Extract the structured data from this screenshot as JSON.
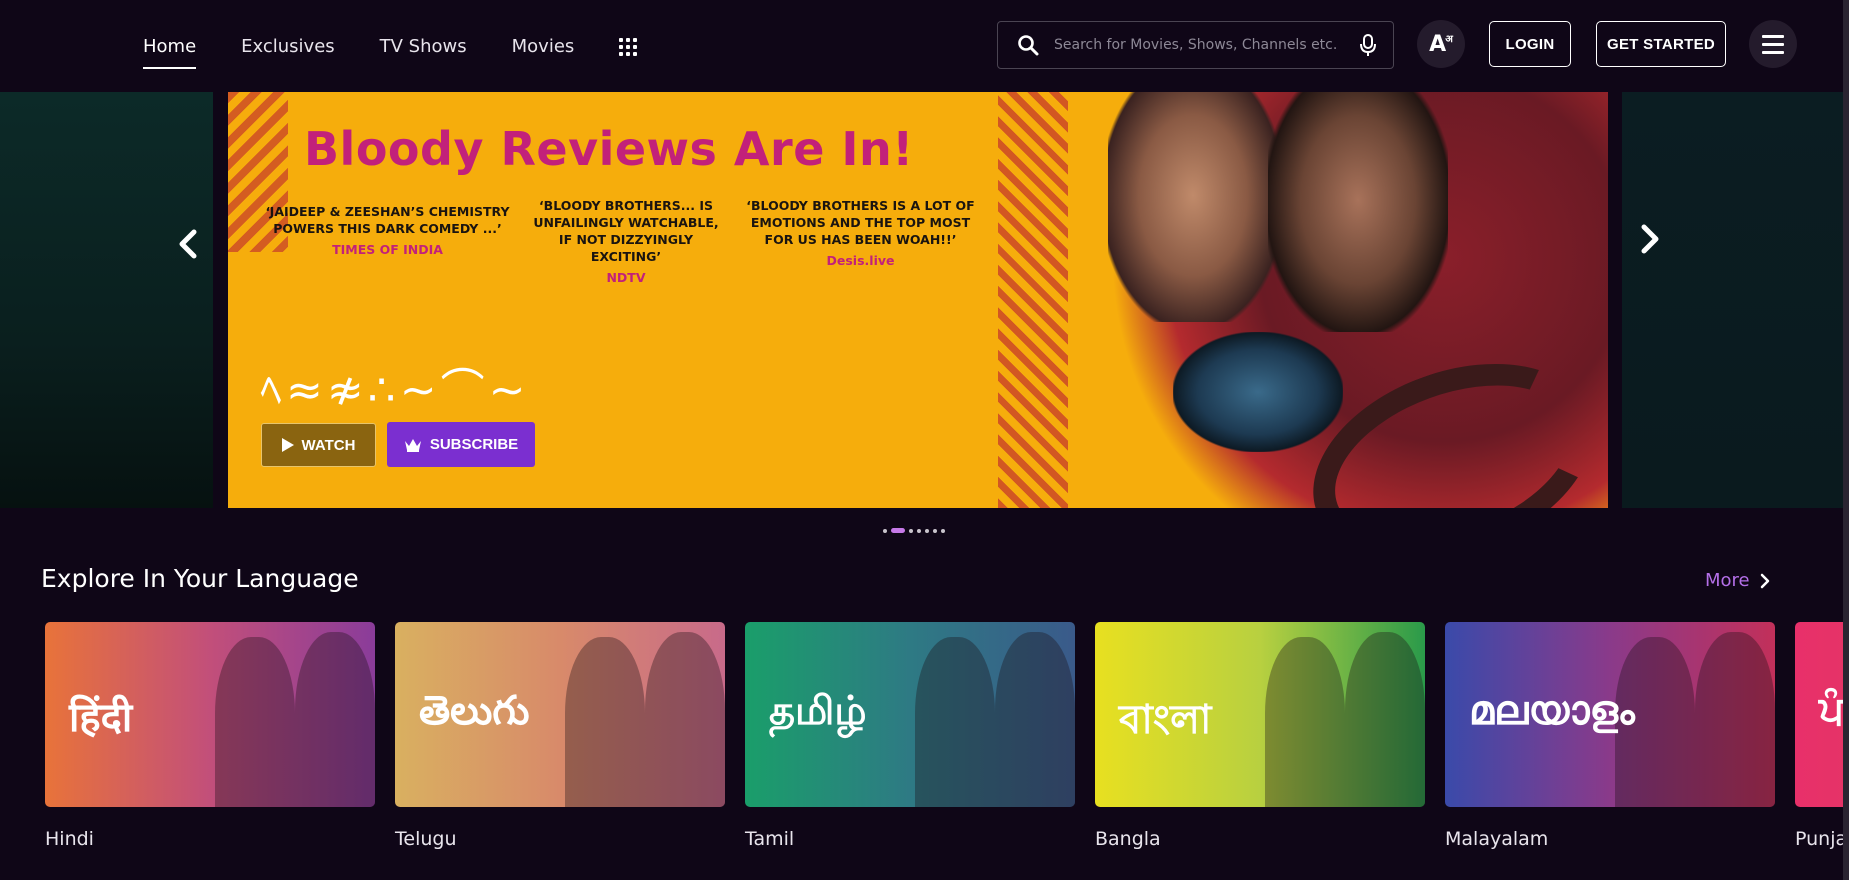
{
  "nav": {
    "items": [
      "Home",
      "Exclusives",
      "TV Shows",
      "Movies"
    ],
    "active": "Home"
  },
  "search": {
    "placeholder": "Search for Movies, Shows, Channels etc."
  },
  "header": {
    "language_icon_label": "A",
    "language_icon_sup": "अ",
    "login_label": "LOGIN",
    "get_started_label": "GET STARTED"
  },
  "hero": {
    "title": "Bloody Reviews Are In!",
    "quotes": [
      {
        "text": "‘JAIDEEP & ZEESHAN’S CHEMISTRY POWERS THIS DARK COMEDY ...’",
        "source": "TIMES OF INDIA"
      },
      {
        "text": "‘BLOODY BROTHERS... IS UNFAILINGLY WATCHABLE, IF NOT DIZZYINGLY EXCITING’",
        "source": "NDTV"
      },
      {
        "text": "‘BLOODY BROTHERS IS A LOT OF EMOTIONS AND THE TOP MOST FOR US HAS BEEN WOAH!!’",
        "source": "Desis.live"
      }
    ],
    "show_logo_text": "ﾍ≈≉∴∼⌒∼",
    "watch_label": "WATCH",
    "subscribe_label": "SUBSCRIBE",
    "slide_count": 7,
    "active_slide": 2
  },
  "explore": {
    "title": "Explore In Your Language",
    "more_label": "More",
    "languages": [
      {
        "label": "Hindi",
        "script": "हिंदी",
        "gradient": [
          "#e8733a",
          "#c24f7a",
          "#8a3c9a"
        ]
      },
      {
        "label": "Telugu",
        "script": "తెలుగు",
        "gradient": [
          "#d9b060",
          "#d88a6a",
          "#c86a8a"
        ]
      },
      {
        "label": "Tamil",
        "script": "தமிழ்",
        "gradient": [
          "#1a9e6a",
          "#2e7a84",
          "#3a5a8a"
        ]
      },
      {
        "label": "Bangla",
        "script": "বাংলা",
        "gradient": [
          "#e8e020",
          "#b8d040",
          "#2a9a4a"
        ]
      },
      {
        "label": "Malayalam",
        "script": "മലയാളം",
        "gradient": [
          "#3a4aaa",
          "#8a3a8a",
          "#c2305a"
        ]
      },
      {
        "label": "Punja",
        "script": "ਪੰ",
        "gradient": [
          "#e8306a",
          "#e03a60",
          "#d8305a"
        ]
      }
    ]
  },
  "colors": {
    "background": "#0f0617",
    "accent_purple": "#7b2fd0",
    "more_link": "#b46fe8",
    "banner_yellow": "#f6ad0c",
    "banner_title": "#c2217a"
  }
}
